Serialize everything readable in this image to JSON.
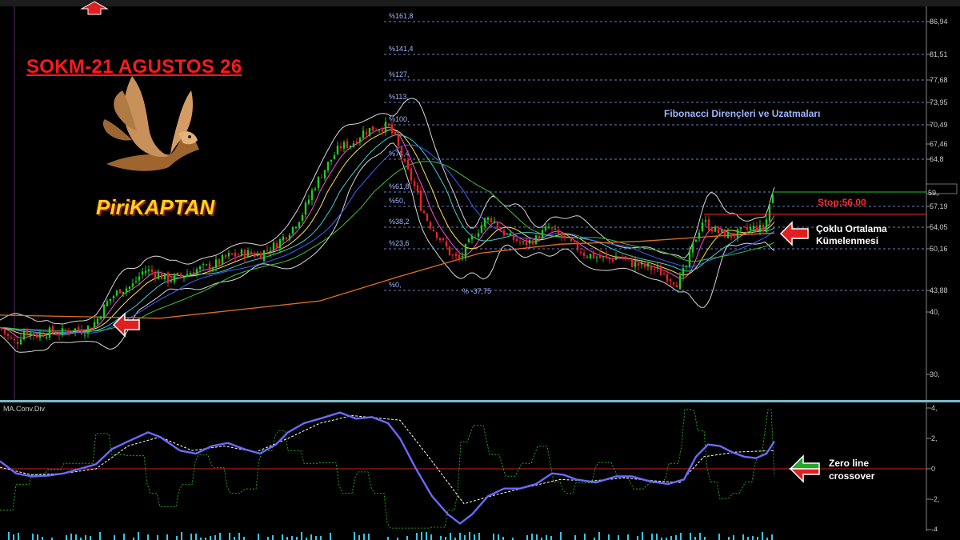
{
  "title": "SOKM-21 AGUSTOS 26",
  "brand": "PiriKAPTAN",
  "annotations": {
    "fibonacci_note": "Fibonacci Dirençleri ve Uzatmaları",
    "stop": "Stop:56.00",
    "cluster_line1": "Çoklu Ortalama",
    "cluster_line2": "Kümelenmesi",
    "zero_line1": "Zero line",
    "zero_line2": "crossover"
  },
  "colors": {
    "background": "#000000",
    "bull_candle": "#22cc22",
    "bear_candle": "#ee2222",
    "bollinger": "#d8d8d8",
    "fib_level": "#6a7fc4",
    "long_ma": "#e07020",
    "macd_line": "#6a6aff",
    "signal_line": "#ffffff",
    "histogram": "#22cc22",
    "zero_line": "#cc2222",
    "stop_line": "#ff2a2a",
    "price_line": "#22cc22"
  },
  "chart_data": [
    {
      "type": "candlestick",
      "title": "SOKM-21 AGUSTOS 26",
      "y_ticks": [
        "86,94",
        "81,51",
        "77,68",
        "73,95",
        "70,49",
        "67,46",
        "64,8",
        "59,",
        "57,19",
        "54,05",
        "50,16",
        "43,88",
        "40,",
        "30,"
      ],
      "y_tick_values": [
        86.94,
        81.51,
        77.68,
        73.95,
        70.49,
        67.46,
        64.8,
        59.0,
        57.19,
        54.05,
        50.16,
        43.88,
        40.0,
        30.0
      ],
      "fibonacci_levels": [
        {
          "label": "%161,8",
          "value": 86.94
        },
        {
          "label": "%141,4",
          "value": 81.51
        },
        {
          "label": "%127,",
          "value": 77.68
        },
        {
          "label": "%113,",
          "value": 73.95
        },
        {
          "label": "%100,",
          "value": 70.49
        },
        {
          "label": "%76,4",
          "value": 64.8
        },
        {
          "label": "%61,8",
          "value": 59.0
        },
        {
          "label": "%50,",
          "value": 57.19
        },
        {
          "label": "%38,2",
          "value": 54.05
        },
        {
          "label": "%23,6",
          "value": 50.16
        },
        {
          "label": "%0,",
          "value": 43.88
        }
      ],
      "fib_extra_label": "% -37,75",
      "stop_level": 56.0,
      "last_price": 59.0,
      "close_path": [
        [
          0,
          37.5
        ],
        [
          10,
          36.0
        ],
        [
          20,
          35.0
        ],
        [
          30,
          37.0
        ],
        [
          45,
          36.3
        ],
        [
          60,
          36.8
        ],
        [
          75,
          36.6
        ],
        [
          90,
          37.3
        ],
        [
          105,
          37.0
        ],
        [
          120,
          38.5
        ],
        [
          135,
          42.0
        ],
        [
          150,
          44.0
        ],
        [
          165,
          44.5
        ],
        [
          180,
          47.0
        ],
        [
          195,
          46.5
        ],
        [
          210,
          45.5
        ],
        [
          225,
          46.0
        ],
        [
          245,
          47.0
        ],
        [
          265,
          47.5
        ],
        [
          285,
          49.0
        ],
        [
          305,
          49.5
        ],
        [
          325,
          49.3
        ],
        [
          345,
          51.0
        ],
        [
          360,
          53.0
        ],
        [
          380,
          56.5
        ],
        [
          395,
          60.5
        ],
        [
          410,
          64.0
        ],
        [
          425,
          67.0
        ],
        [
          440,
          67.5
        ],
        [
          455,
          69.5
        ],
        [
          470,
          70.0
        ],
        [
          485,
          70.3
        ],
        [
          495,
          68.0
        ],
        [
          505,
          64.0
        ],
        [
          515,
          61.0
        ],
        [
          525,
          57.5
        ],
        [
          535,
          55.0
        ],
        [
          545,
          53.0
        ],
        [
          555,
          51.0
        ],
        [
          565,
          49.0
        ],
        [
          575,
          48.5
        ],
        [
          585,
          51.0
        ],
        [
          595,
          53.0
        ],
        [
          605,
          55.0
        ],
        [
          615,
          55.5
        ],
        [
          625,
          53.5
        ],
        [
          640,
          52.0
        ],
        [
          655,
          51.0
        ],
        [
          670,
          52.0
        ],
        [
          685,
          54.0
        ],
        [
          700,
          52.5
        ],
        [
          715,
          51.0
        ],
        [
          730,
          49.5
        ],
        [
          745,
          49.0
        ],
        [
          760,
          48.5
        ],
        [
          775,
          49.0
        ],
        [
          790,
          48.0
        ],
        [
          805,
          47.5
        ],
        [
          820,
          47.0
        ],
        [
          835,
          46.0
        ],
        [
          848,
          45.0
        ],
        [
          858,
          47.5
        ],
        [
          868,
          51.5
        ],
        [
          878,
          55.0
        ],
        [
          888,
          54.0
        ],
        [
          900,
          53.0
        ],
        [
          915,
          52.5
        ],
        [
          930,
          53.5
        ],
        [
          945,
          54.0
        ],
        [
          955,
          53.5
        ],
        [
          962,
          57.5
        ],
        [
          968,
          59.0
        ]
      ],
      "long_ma_path": [
        [
          0,
          39.5
        ],
        [
          200,
          39.0
        ],
        [
          400,
          42.0
        ],
        [
          500,
          46.0
        ],
        [
          600,
          49.5
        ],
        [
          700,
          51.0
        ],
        [
          800,
          51.5
        ],
        [
          900,
          52.5
        ],
        [
          968,
          53.0
        ]
      ]
    },
    {
      "type": "line",
      "title": "MA.Conv.Div",
      "y_ticks": [
        "4,",
        "2,",
        "0",
        "-2,",
        "-4,"
      ],
      "y_tick_values": [
        4,
        2,
        0,
        -2,
        -4
      ],
      "series": [
        {
          "values": [
            [
              0,
              0.5
            ],
            [
              20,
              -0.3
            ],
            [
              40,
              -0.5
            ],
            [
              60,
              -0.45
            ],
            [
              80,
              -0.3
            ],
            [
              100,
              0.0
            ],
            [
              120,
              0.3
            ],
            [
              140,
              1.3
            ],
            [
              160,
              1.8
            ],
            [
              185,
              2.4
            ],
            [
              200,
              2.1
            ],
            [
              225,
              1.2
            ],
            [
              245,
              1.0
            ],
            [
              265,
              1.5
            ],
            [
              285,
              1.7
            ],
            [
              305,
              1.3
            ],
            [
              325,
              1.0
            ],
            [
              345,
              1.6
            ],
            [
              360,
              2.4
            ],
            [
              380,
              3.0
            ],
            [
              400,
              3.3
            ],
            [
              425,
              3.7
            ],
            [
              445,
              3.3
            ],
            [
              465,
              3.4
            ],
            [
              485,
              3.0
            ],
            [
              500,
              2.0
            ],
            [
              520,
              0.0
            ],
            [
              540,
              -1.8
            ],
            [
              560,
              -3.0
            ],
            [
              575,
              -3.6
            ],
            [
              590,
              -3.0
            ],
            [
              610,
              -1.8
            ],
            [
              630,
              -1.3
            ],
            [
              650,
              -1.3
            ],
            [
              670,
              -1.0
            ],
            [
              690,
              -0.3
            ],
            [
              705,
              -0.4
            ],
            [
              720,
              -0.7
            ],
            [
              745,
              -0.9
            ],
            [
              770,
              -0.5
            ],
            [
              790,
              -0.5
            ],
            [
              810,
              -0.8
            ],
            [
              835,
              -1.0
            ],
            [
              855,
              -0.7
            ],
            [
              870,
              0.8
            ],
            [
              885,
              1.6
            ],
            [
              900,
              1.5
            ],
            [
              915,
              1.1
            ],
            [
              930,
              0.8
            ],
            [
              945,
              0.7
            ],
            [
              958,
              1.0
            ],
            [
              968,
              1.8
            ]
          ]
        },
        {
          "values": [
            [
              0,
              0.1
            ],
            [
              40,
              -0.4
            ],
            [
              80,
              -0.3
            ],
            [
              120,
              0.0
            ],
            [
              160,
              1.5
            ],
            [
              200,
              2.1
            ],
            [
              240,
              1.2
            ],
            [
              280,
              1.5
            ],
            [
              320,
              1.1
            ],
            [
              360,
              2.0
            ],
            [
              400,
              3.0
            ],
            [
              440,
              3.5
            ],
            [
              480,
              3.3
            ],
            [
              500,
              3.2
            ],
            [
              540,
              0.5
            ],
            [
              580,
              -2.3
            ],
            [
              620,
              -1.7
            ],
            [
              660,
              -1.2
            ],
            [
              700,
              -0.7
            ],
            [
              740,
              -0.8
            ],
            [
              780,
              -0.6
            ],
            [
              820,
              -0.8
            ],
            [
              850,
              -0.9
            ],
            [
              880,
              0.8
            ],
            [
              920,
              1.1
            ],
            [
              968,
              1.2
            ]
          ]
        }
      ]
    }
  ]
}
